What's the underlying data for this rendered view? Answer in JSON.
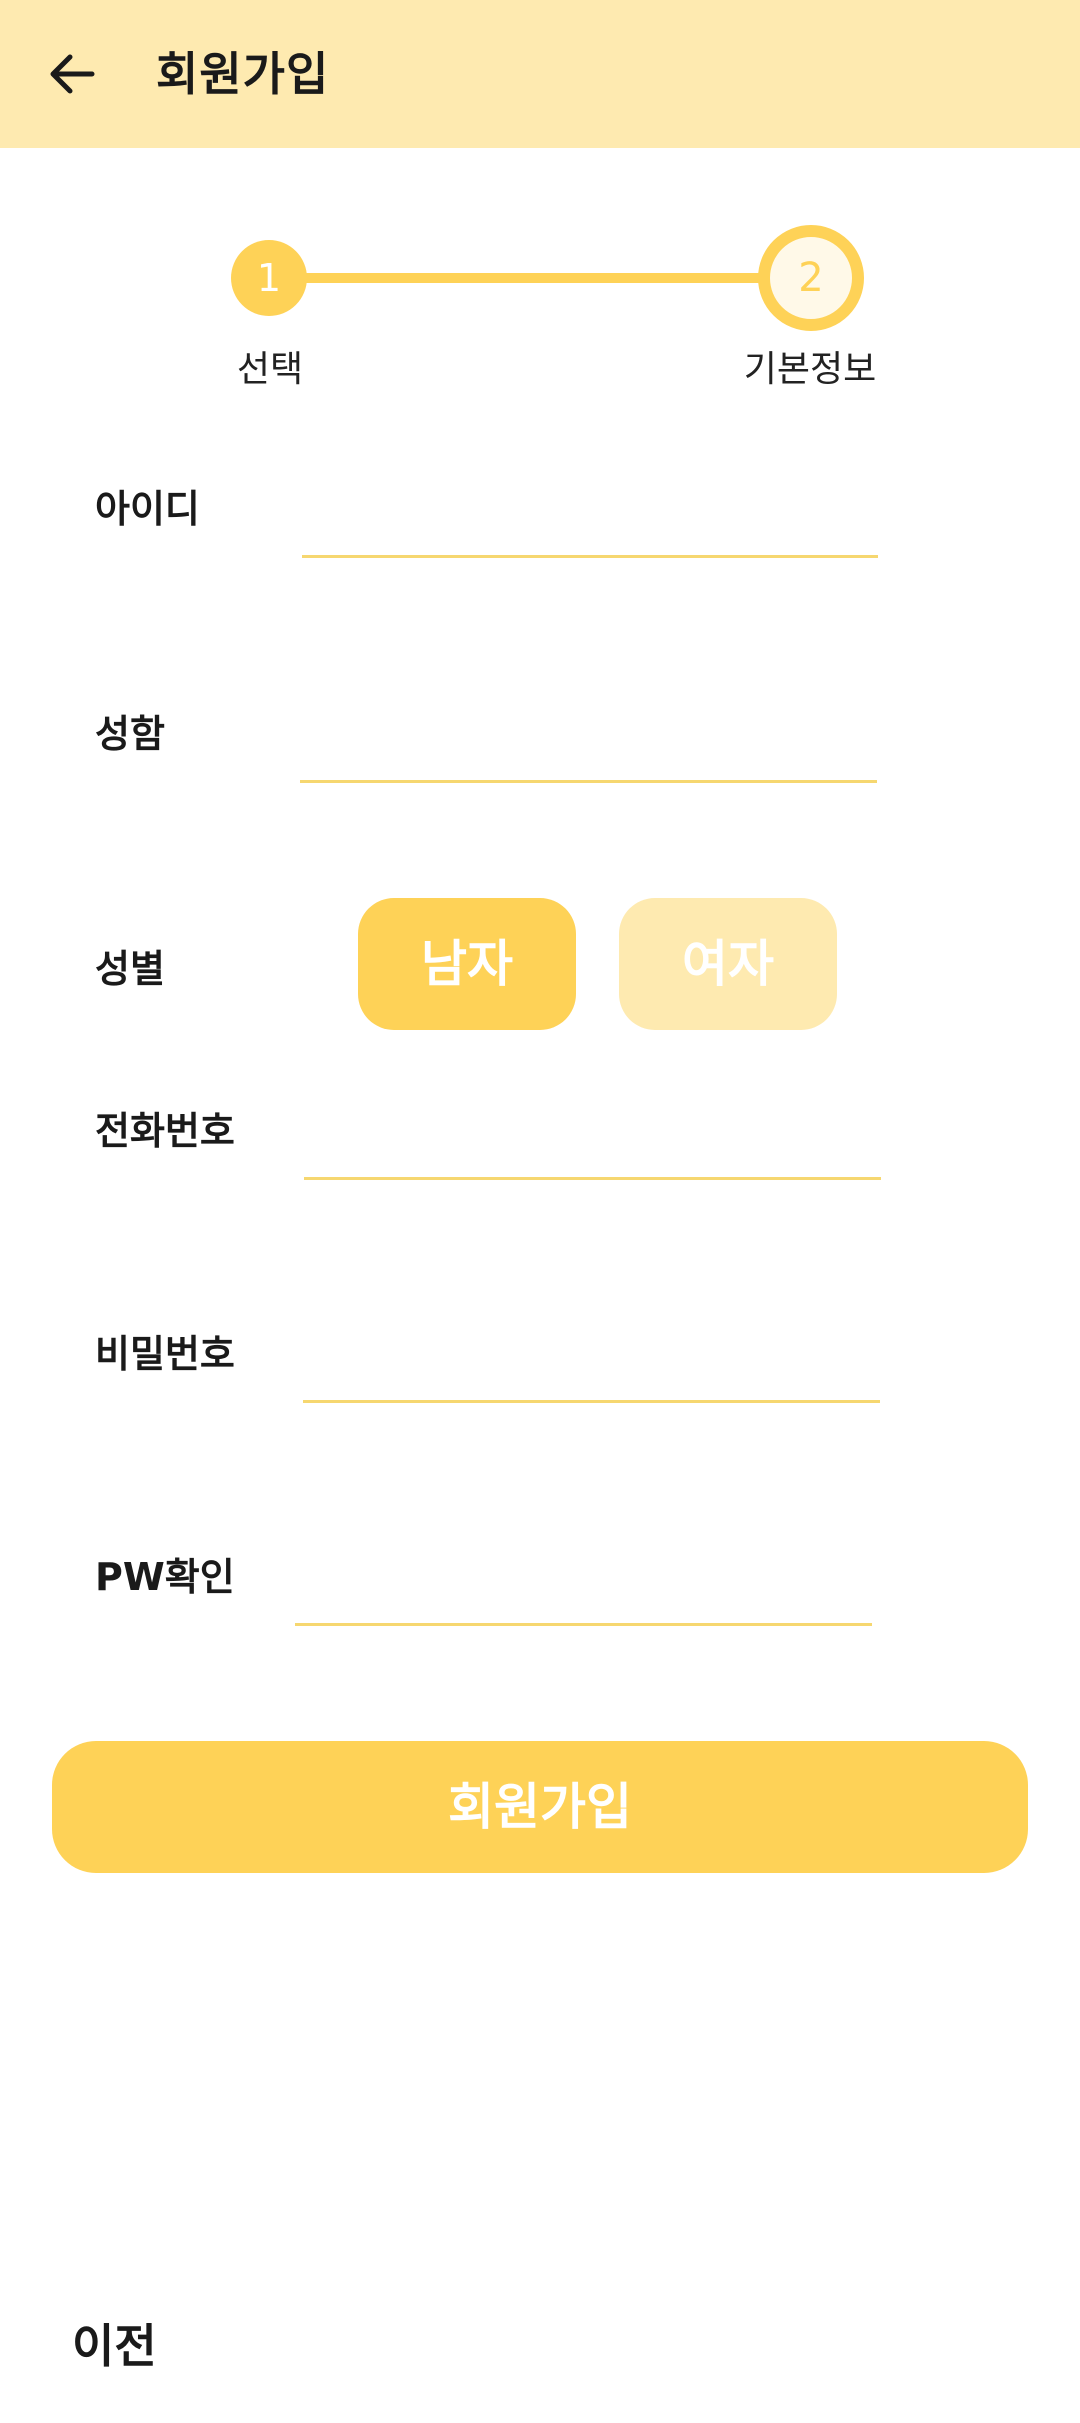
{
  "appbar": {
    "title": "회원가입",
    "back_icon": "arrow-left-icon",
    "background": "#feeab0"
  },
  "stepper": {
    "steps": [
      {
        "number": "1",
        "label": "선택"
      },
      {
        "number": "2",
        "label": "기본정보"
      }
    ],
    "current_step": 2,
    "accent": "#fed257"
  },
  "form": {
    "id_label": "아이디",
    "id_value": "",
    "name_label": "성함",
    "name_value": "",
    "gender_label": "성별",
    "gender_options": [
      "남자",
      "여자"
    ],
    "gender_selected": "남자",
    "phone_label": "전화번호",
    "phone_value": "",
    "password_label": "비밀번호",
    "password_value": "",
    "confirm_label": "PW확인",
    "confirm_value": ""
  },
  "actions": {
    "signup_label": "회원가입",
    "prev_label": "이전"
  }
}
